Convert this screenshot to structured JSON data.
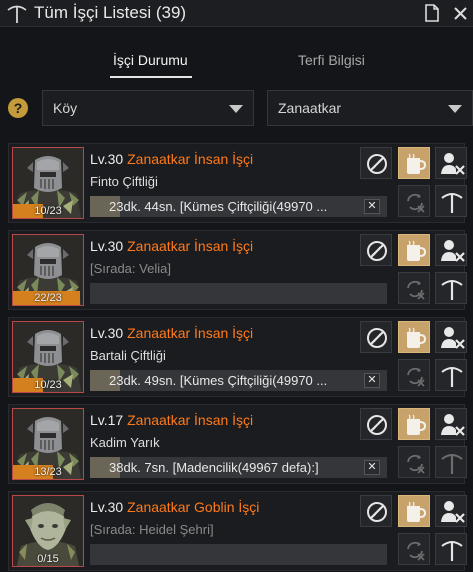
{
  "window": {
    "title": "Tüm İşçi Listesi (39)"
  },
  "tabs": [
    {
      "label": "İşçi Durumu",
      "active": true
    },
    {
      "label": "Terfi Bilgisi",
      "active": false
    }
  ],
  "filters": {
    "help_label": "?",
    "location": {
      "selected": "Köy"
    },
    "profession": {
      "selected": "Zanaatkar"
    }
  },
  "workers": [
    {
      "level": "Lv.30",
      "job": "Zanaatkar İnsan İşçi",
      "status": "Finto Çiftliği",
      "queued": false,
      "stamina": "10/23",
      "stamina_pct": 43,
      "task": "23dk. 44sn. [Kümes Çiftçiliği(49970 ...",
      "task_progress_pct": 0.1,
      "portrait": "human",
      "dim_action": false
    },
    {
      "level": "Lv.30",
      "job": "Zanaatkar İnsan İşçi",
      "status": "[Sırada: Velia]",
      "queued": true,
      "stamina": "22/23",
      "stamina_pct": 96,
      "task": "",
      "task_progress_pct": 0,
      "portrait": "human",
      "dim_action": false
    },
    {
      "level": "Lv.30",
      "job": "Zanaatkar İnsan İşçi",
      "status": "Bartali Çiftliği",
      "queued": false,
      "stamina": "10/23",
      "stamina_pct": 43,
      "task": "23dk. 49sn. [Kümes Çiftçiliği(49970 ...",
      "task_progress_pct": 0.1,
      "portrait": "human",
      "dim_action": false
    },
    {
      "level": "Lv.17",
      "job": "Zanaatkar İnsan İşçi",
      "status": "Kadim Yarık",
      "queued": false,
      "stamina": "13/23",
      "stamina_pct": 57,
      "task": "38dk. 7sn. [Madencilik(49967 defa):]",
      "task_progress_pct": 0.1,
      "portrait": "human",
      "dim_action": true
    },
    {
      "level": "Lv.30",
      "job": "Zanaatkar Goblin İşçi",
      "status": "[Sırada: Heidel Şehri]",
      "queued": true,
      "stamina": "0/15",
      "stamina_pct": 0,
      "task": "",
      "task_progress_pct": 0,
      "portrait": "goblin",
      "dim_action": false
    }
  ],
  "task_cancel_label": "✕",
  "colors": {
    "accent": "#ff7a1a",
    "stamina": "#d4801e",
    "gold_button": "#c7a26a",
    "portrait_border": "#b94848"
  }
}
